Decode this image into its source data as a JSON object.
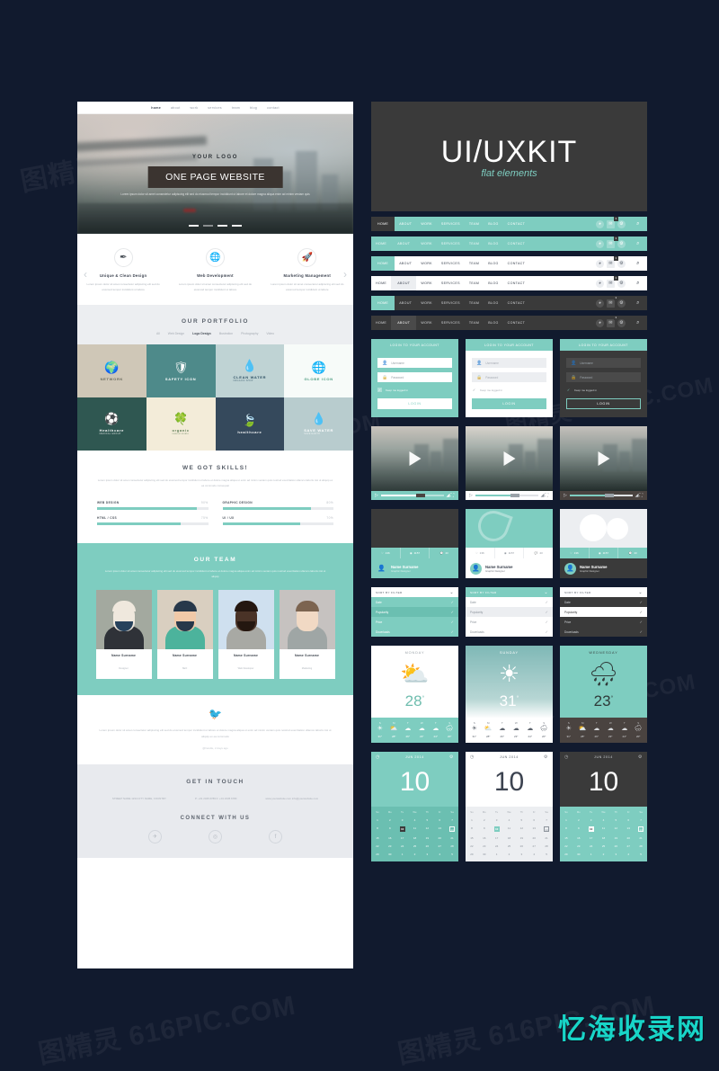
{
  "theme": {
    "bg": "#111a2e",
    "teal": "#7ecdc0",
    "dark": "#3a3a3a",
    "light": "#ffffff",
    "grey": "#eceef1"
  },
  "watermarks": {
    "tile": "图精灵 616PIC.COM",
    "brand": "忆海收录网"
  },
  "left_page": {
    "nav": [
      "home",
      "about",
      "work",
      "services",
      "team",
      "blog",
      "contact"
    ],
    "hero": {
      "logo": "YOUR LOGO",
      "button": "ONE PAGE WEBSITE",
      "subtitle": "Lorem ipsum dolor sit amet consectetur adipiscing elit sed do eiusmod tempor incididunt ut labore et dolore magna aliqua enim ad minim veniam quis"
    },
    "features": {
      "prev": "‹",
      "next": "›",
      "items": [
        {
          "icon": "pen-icon",
          "glyph": "✒",
          "title": "Unique & Clean Design",
          "text": "Lorem ipsum dolor sit amet consectetur adipiscing elit sed do eiusmod tempor incididunt ut labore"
        },
        {
          "icon": "globe-icon",
          "glyph": "🌐",
          "title": "Web Development",
          "text": "Lorem ipsum dolor sit amet consectetur adipiscing elit sed do eiusmod tempor incididunt ut labore"
        },
        {
          "icon": "rocket-icon",
          "glyph": "🚀",
          "title": "Marketing Management",
          "text": "Lorem ipsum dolor sit amet consectetur adipiscing elit sed do eiusmod tempor incididunt ut labore"
        }
      ]
    },
    "portfolio": {
      "title": "OUR PORTFOLIO",
      "filters": [
        "All",
        "Web Design",
        "Logo Design",
        "Illustration",
        "Photography",
        "Video"
      ],
      "active_filter": "Logo Design",
      "tiles": [
        {
          "name": "NETWORK",
          "sub": "",
          "glyph": "🌍",
          "bg": "#cfc7b7",
          "fg": "#6a6a5c"
        },
        {
          "name": "SAFETY ICON",
          "sub": "",
          "glyph": "🛡",
          "bg": "#4e8a8a",
          "fg": "#ffffff"
        },
        {
          "name": "CLEAN WATER",
          "sub": "ORGANIC SHOP",
          "glyph": "💧",
          "bg": "#bfd3d4",
          "fg": "#2d4f63"
        },
        {
          "name": "GLOBE ICON",
          "sub": "",
          "glyph": "🌐",
          "bg": "#f7fbf9",
          "fg": "#4a9b7f"
        },
        {
          "name": "Healthcare",
          "sub": "MEDICAL GROUP",
          "glyph": "⚽",
          "bg": "#2f5751",
          "fg": "#ffffff"
        },
        {
          "name": "organic",
          "sub": "natural studio",
          "glyph": "🍀",
          "bg": "#f3ecd9",
          "fg": "#5b7a52"
        },
        {
          "name": "healthcare",
          "sub": "",
          "glyph": "🍃",
          "bg": "#35495c",
          "fg": "#ffffff"
        },
        {
          "name": "SAVE WATER",
          "sub": "SAVE EARTH",
          "glyph": "💧",
          "bg": "#b8ccce",
          "fg": "#ffffff"
        }
      ]
    },
    "skills": {
      "title": "WE GOT SKILLS!",
      "lead": "Lorem ipsum dolor sit amet consectetur adipiscing elit sed do eiusmod tempor incididunt ut labore et dolore magna aliqua ut enim ad minim veniam quis nostrud exercitation ullamco laboris nisi ut aliquip ex ea commodo consequat",
      "bars": [
        {
          "label": "WEB DESIGN",
          "value": "90%",
          "pct": 90
        },
        {
          "label": "GRAPHIC DESIGN",
          "value": "80%",
          "pct": 80
        },
        {
          "label": "HTML / CSS",
          "value": "75%",
          "pct": 75
        },
        {
          "label": "UI / UX",
          "value": "70%",
          "pct": 70
        }
      ]
    },
    "team": {
      "title": "OUR TEAM",
      "lead": "Lorem ipsum dolor sit amet consectetur adipiscing elit sed do eiusmod tempor incididunt ut labore et dolore magna aliqua enim ad minim veniam quis nostrud exercitation ullamco laboris nisi ut aliquip",
      "members": [
        {
          "name": "Name Surname",
          "role": "Designer"
        },
        {
          "name": "Name Surname",
          "role": "SEO"
        },
        {
          "name": "Name Surname",
          "role": "Web Developer"
        },
        {
          "name": "Name Surname",
          "role": "Marketing"
        }
      ]
    },
    "tweet": {
      "icon": "twitter-bird-icon",
      "text": "Lorem ipsum dolor sit amet consectetur adipiscing elit sed do eiusmod tempor incididunt ut labore et dolore magna aliqua ut enim ad minim veniam quis nostrud exercitation ullamco laboris nisi ut aliquip ex ea commodo",
      "author": "@handle, 2 days ago"
    },
    "contact": {
      "title": "GET IN TOUCH",
      "columns": [
        "STREET NAME 1234\nCITY NAME, COUNTRY",
        "P: +01 2345 6789\nF: +01 2345 6780",
        "www.yourwebsite.com\ninfo@yourwebsite.com"
      ],
      "connect_title": "CONNECT WITH US",
      "socials": [
        {
          "name": "twitter-icon",
          "glyph": "✈"
        },
        {
          "name": "dribbble-icon",
          "glyph": "◎"
        },
        {
          "name": "facebook-icon",
          "glyph": "f"
        }
      ]
    }
  },
  "right_panel": {
    "header": {
      "title_1": "UI",
      "slash": "/",
      "title_2": "UX",
      "title_3": "KIT",
      "subtitle": "flat elements"
    },
    "navbars": {
      "items": [
        "HOME",
        "ABOUT",
        "WORK",
        "SERVICES",
        "TEAM",
        "BLOG",
        "CONTACT"
      ],
      "icons": [
        "user-icon",
        "mail-icon",
        "gear-icon"
      ],
      "search_icon": "search-icon",
      "badge": "3",
      "variants": [
        {
          "style": "teal-dark-home",
          "active": "HOME"
        },
        {
          "style": "teal-flat",
          "active": "ABOUT"
        },
        {
          "style": "white-teal-home",
          "active": "HOME"
        },
        {
          "style": "white-grey-about",
          "active": "ABOUT"
        },
        {
          "style": "dark-teal-home",
          "active": "HOME"
        },
        {
          "style": "dark-about",
          "active": "ABOUT"
        }
      ]
    },
    "login": {
      "title": "LOGIN TO YOUR ACCOUNT",
      "username_placeholder": "Username",
      "password_placeholder": "Password",
      "keep_logged": "Keep me logged in",
      "button": "LOGIN",
      "user_icon": "user-icon",
      "lock_icon": "lock-icon",
      "check_icon": "check-icon",
      "variants": [
        "teal",
        "white",
        "dark"
      ]
    },
    "video": {
      "play_icon": "play-icon",
      "fullscreen_icon": "fullscreen-icon",
      "volume_icon": "volume-icon",
      "variants": [
        "teal",
        "white",
        "dark"
      ]
    },
    "profile_cards": {
      "name": "Name Surname",
      "role": "Graphic Designer",
      "avatar_icon": "avatar-icon",
      "stats": [
        {
          "icon": "heart-icon",
          "glyph": "♡",
          "value": "136"
        },
        {
          "icon": "eye-icon",
          "glyph": "◉",
          "value": "1157"
        },
        {
          "icon": "comment-icon",
          "glyph": "💬",
          "value": "43"
        }
      ],
      "variants": [
        "dark",
        "teal",
        "white"
      ]
    },
    "sort_filter": {
      "title": "SORT BY FILTER",
      "chevron_icon": "chevron-down-icon",
      "check_icon": "check-icon",
      "options": [
        "Date",
        "Popularity",
        "Price",
        "Downloads"
      ],
      "selected": "Popularity",
      "variants": [
        "teal",
        "white",
        "dark"
      ]
    },
    "weather": [
      {
        "day": "MONDAY",
        "temp": "28",
        "unit": "°",
        "icon": "sun-cloud-icon",
        "glyph": "⛅",
        "style": "white",
        "forecast_days": [
          "S",
          "M",
          "T",
          "W",
          "T",
          "S"
        ],
        "forecast_icons": [
          "☀",
          "⛅",
          "☁",
          "☁",
          "☁",
          "🌧"
        ],
        "forecast_temps": [
          "31°",
          "28°",
          "26°",
          "23°",
          "24°",
          "20°"
        ]
      },
      {
        "day": "SUNDAY",
        "temp": "31",
        "unit": "°",
        "icon": "sun-icon",
        "glyph": "☀",
        "style": "photo",
        "forecast_days": [
          "S",
          "M",
          "T",
          "W",
          "T",
          "S"
        ],
        "forecast_icons": [
          "☀",
          "⛅",
          "☁",
          "☁",
          "☁",
          "🌧"
        ],
        "forecast_temps": [
          "31°",
          "28°",
          "26°",
          "23°",
          "24°",
          "20°"
        ]
      },
      {
        "day": "WEDNESDAY",
        "temp": "23",
        "unit": "°",
        "icon": "rain-cloud-icon",
        "glyph": "🌧",
        "style": "teal",
        "forecast_days": [
          "S",
          "M",
          "T",
          "W",
          "T",
          "S"
        ],
        "forecast_icons": [
          "☀",
          "⛅",
          "☁",
          "☁",
          "☁",
          "🌧"
        ],
        "forecast_temps": [
          "31°",
          "28°",
          "26°",
          "23°",
          "24°",
          "20°"
        ]
      }
    ],
    "calendar": {
      "month": "JUN 2014",
      "day_big": "10",
      "clock_icon": "clock-icon",
      "gear_icon": "gear-icon",
      "dow": [
        "Su",
        "Mo",
        "Tu",
        "We",
        "Th",
        "Fr",
        "Sa"
      ],
      "weeks": [
        [
          "1",
          "2",
          "3",
          "4",
          "5",
          "6",
          "7"
        ],
        [
          "8",
          "9",
          "10",
          "11",
          "12",
          "13",
          "14"
        ],
        [
          "15",
          "16",
          "17",
          "18",
          "19",
          "20",
          "21"
        ],
        [
          "22",
          "23",
          "24",
          "25",
          "26",
          "27",
          "28"
        ],
        [
          "29",
          "30",
          "1",
          "2",
          "3",
          "4",
          "5"
        ]
      ],
      "selected": "10",
      "today": "14",
      "variants": [
        "teal",
        "white",
        "dark"
      ]
    }
  }
}
